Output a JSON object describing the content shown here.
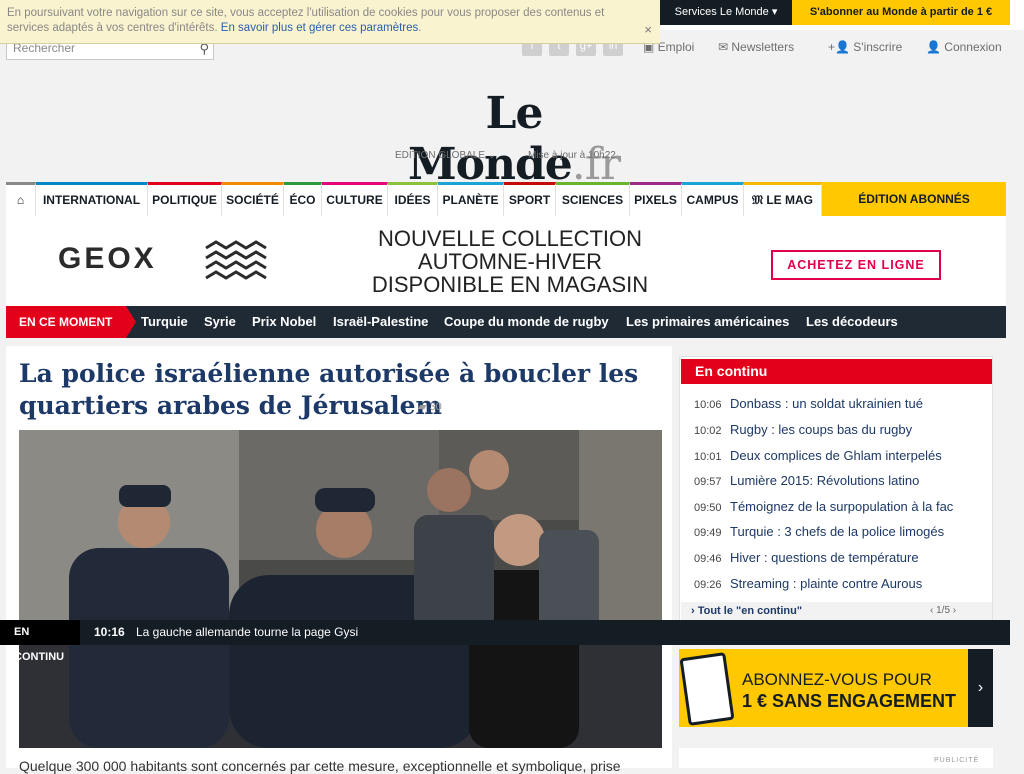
{
  "cookie": {
    "text": "En poursuivant votre navigation sur ce site, vous acceptez l'utilisation de cookies pour vous proposer des contenus et services adaptés à vos centres d'intérêts.",
    "link": "En savoir plus et gérer ces paramètres",
    "close": "×"
  },
  "search": {
    "placeholder": "Rechercher"
  },
  "social": [
    "f",
    "t",
    "g+",
    "in"
  ],
  "top_links": {
    "emploi": "Emploi",
    "newsletters": "Newsletters",
    "inscrire": "S'inscrire",
    "connexion": "Connexion"
  },
  "services": "Services Le Monde ▾",
  "subscribe": "S'abonner au Monde à partir de 1 €",
  "logo": {
    "main": "Le Monde",
    "suffix": ".fr"
  },
  "edition": "EDITION GLOBALE ⌄",
  "updated": "Mise à jour à 10h22",
  "nav": {
    "home_icon": "⌂",
    "items": [
      "INTERNATIONAL",
      "POLITIQUE",
      "SOCIÉTÉ",
      "ÉCO",
      "CULTURE",
      "IDÉES",
      "PLANÈTE",
      "SPORT",
      "SCIENCES",
      "PIXELS",
      "CAMPUS",
      "𝔐 LE MAG"
    ],
    "abonnes": "ÉDITION ABONNÉS",
    "colors": [
      "#888888",
      "#0386c3",
      "#e3001b",
      "#f18a00",
      "#2b9a3c",
      "#e5007d",
      "#8ac23d",
      "#1aa5d7",
      "#c60a0a",
      "#69b42a",
      "#9e2a8c",
      "#1aa5d7",
      "#f6b800"
    ]
  },
  "ad": {
    "brand": "GEOX",
    "line1": "NOUVELLE COLLECTION",
    "line2": "AUTOMNE-HIVER",
    "line3": "DISPONIBLE EN MAGASIN",
    "button": "ACHETEZ EN LIGNE"
  },
  "moment": {
    "label": "EN CE MOMENT",
    "links": [
      "Turquie",
      "Syrie",
      "Prix Nobel",
      "Israël-Palestine",
      "Coupe du monde de rugby",
      "Les primaires américaines",
      "Les décodeurs"
    ]
  },
  "article": {
    "headline": "La police israélienne autorisée à boucler les quartiers arabes de Jérusalem",
    "comments": "30",
    "caption": "Quelque 300 000 habitants sont concernés par cette mesure, exceptionnelle et symbolique, prise"
  },
  "en_continu": {
    "title": "En continu",
    "items": [
      {
        "time": "10:06",
        "text": "Donbass : un soldat ukrainien tué"
      },
      {
        "time": "10:02",
        "text": "Rugby : les coups bas du rugby"
      },
      {
        "time": "10:01",
        "text": "Deux complices de Ghlam interpelés"
      },
      {
        "time": "09:57",
        "text": "Lumière 2015: Révolutions latino"
      },
      {
        "time": "09:50",
        "text": "Témoignez de la surpopulation à la fac"
      },
      {
        "time": "09:49",
        "text": "Turquie : 3 chefs de la police limogés"
      },
      {
        "time": "09:46",
        "text": "Hiver : questions de température"
      },
      {
        "time": "09:26",
        "text": "Streaming : plainte contre Aurous"
      }
    ],
    "all_link": "› Tout le \"en continu\"",
    "pager": "‹  1/5  ›"
  },
  "ticker": {
    "label": "EN CONTINU",
    "time": "10:16",
    "text": "La gauche allemande tourne la page Gysi"
  },
  "promo": {
    "line1": "ABONNEZ-VOUS POUR",
    "line2": "1 € SANS ENGAGEMENT",
    "arrow": "›"
  },
  "pub": "PUBLICITÉ"
}
